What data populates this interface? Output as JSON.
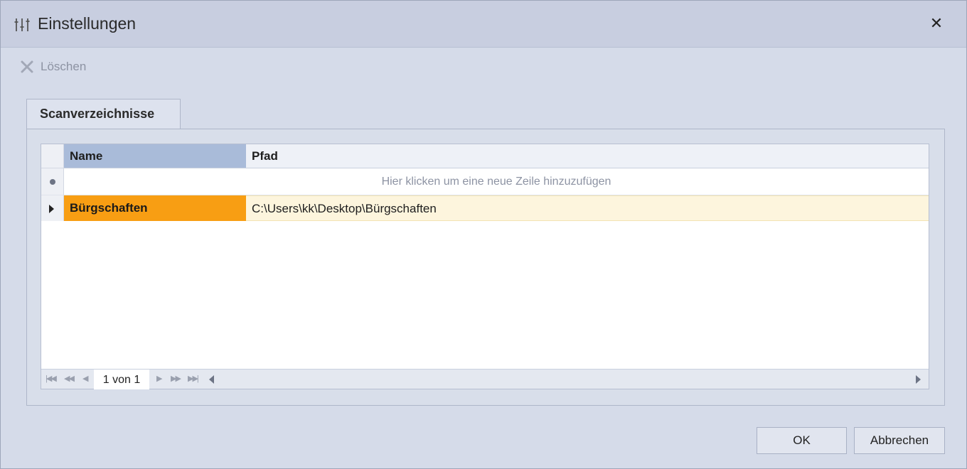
{
  "window": {
    "title": "Einstellungen",
    "close_label": "✕"
  },
  "toolbar": {
    "delete_label": "Löschen"
  },
  "tabs": [
    {
      "label": "Scanverzeichnisse"
    }
  ],
  "grid": {
    "columns": [
      {
        "label": "Name"
      },
      {
        "label": "Pfad"
      }
    ],
    "new_row_hint": "Hier klicken um eine neue Zeile hinzuzufügen",
    "rows": [
      {
        "name": "Bürgschaften",
        "path": "C:\\Users\\kk\\Desktop\\Bürgschaften"
      }
    ],
    "navigator": {
      "page_info": "1 von 1"
    }
  },
  "buttons": {
    "ok": "OK",
    "cancel": "Abbrechen"
  },
  "colors": {
    "selected_name_cell": "#f89e13",
    "selected_row": "#fdf5dd",
    "header_active": "#a9bbd9"
  }
}
